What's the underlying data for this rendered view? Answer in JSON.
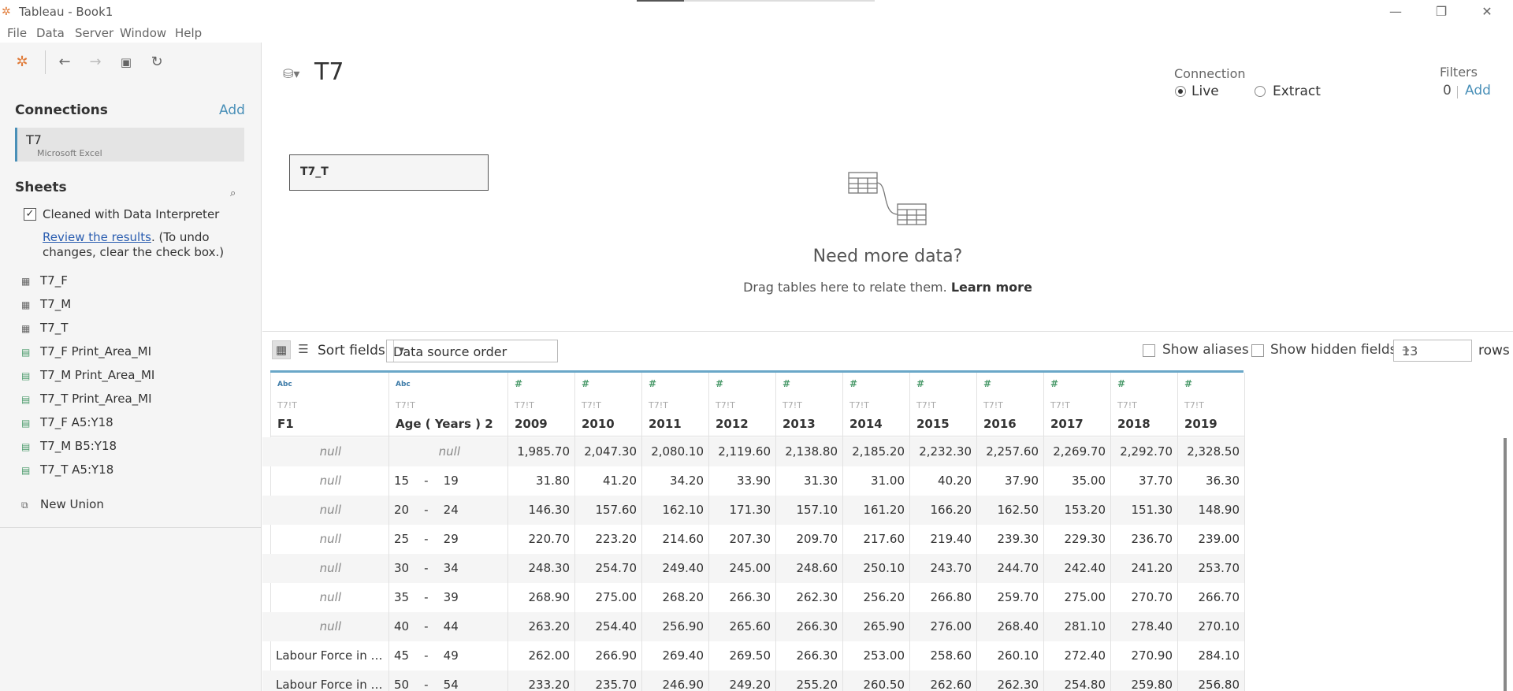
{
  "window": {
    "title": "Tableau - Book1",
    "progress_fraction": 0.2
  },
  "menu": [
    "File",
    "Data",
    "Server",
    "Window",
    "Help"
  ],
  "left": {
    "connections_title": "Connections",
    "connections_add": "Add",
    "connection": {
      "name": "T7",
      "type": "Microsoft Excel"
    },
    "sheets_title": "Sheets",
    "interpreter_label": "Cleaned with Data Interpreter",
    "interpreter_checked": true,
    "review_link": "Review the results",
    "review_rest": ". (To undo changes, clear the check box.)",
    "sheets": [
      {
        "name": "T7_F",
        "icon": "table-icon"
      },
      {
        "name": "T7_M",
        "icon": "table-icon"
      },
      {
        "name": "T7_T",
        "icon": "table-icon"
      },
      {
        "name": "T7_F Print_Area_MI",
        "icon": "named-range-icon"
      },
      {
        "name": "T7_M Print_Area_MI",
        "icon": "named-range-icon"
      },
      {
        "name": "T7_T Print_Area_MI",
        "icon": "named-range-icon"
      },
      {
        "name": "T7_F A5:Y18",
        "icon": "named-range-icon"
      },
      {
        "name": "T7_M B5:Y18",
        "icon": "named-range-icon"
      },
      {
        "name": "T7_T A5:Y18",
        "icon": "named-range-icon"
      }
    ],
    "new_union": "New Union"
  },
  "canvas": {
    "datasource_title": "T7",
    "connection_label": "Connection",
    "live_label": "Live",
    "extract_label": "Extract",
    "filters_label": "Filters",
    "filters_count": "0",
    "filters_add": "Add",
    "table_name": "T7_T",
    "need_title": "Need more data?",
    "need_sub": "Drag tables here to relate them.",
    "learn_more": "Learn more"
  },
  "gridbar": {
    "sort_label": "Sort fields",
    "sort_value": "Data source order",
    "show_aliases": "Show aliases",
    "show_hidden": "Show hidden fields",
    "rows_value": "13",
    "rows_label": "rows"
  },
  "grid": {
    "columns": [
      {
        "type": "Abc",
        "source": "T7!T",
        "name": "F1"
      },
      {
        "type": "Abc",
        "source": "T7!T",
        "name": "Age ( Years ) 2"
      },
      {
        "type": "#",
        "source": "T7!T",
        "name": "2009"
      },
      {
        "type": "#",
        "source": "T7!T",
        "name": "2010"
      },
      {
        "type": "#",
        "source": "T7!T",
        "name": "2011"
      },
      {
        "type": "#",
        "source": "T7!T",
        "name": "2012"
      },
      {
        "type": "#",
        "source": "T7!T",
        "name": "2013"
      },
      {
        "type": "#",
        "source": "T7!T",
        "name": "2014"
      },
      {
        "type": "#",
        "source": "T7!T",
        "name": "2015"
      },
      {
        "type": "#",
        "source": "T7!T",
        "name": "2016"
      },
      {
        "type": "#",
        "source": "T7!T",
        "name": "2017"
      },
      {
        "type": "#",
        "source": "T7!T",
        "name": "2018"
      },
      {
        "type": "#",
        "source": "T7!T",
        "name": "2019"
      }
    ],
    "rows": [
      [
        "null",
        "null",
        "1,985.70",
        "2,047.30",
        "2,080.10",
        "2,119.60",
        "2,138.80",
        "2,185.20",
        "2,232.30",
        "2,257.60",
        "2,269.70",
        "2,292.70",
        "2,328.50"
      ],
      [
        "null",
        "15    -    19",
        "31.80",
        "41.20",
        "34.20",
        "33.90",
        "31.30",
        "31.00",
        "40.20",
        "37.90",
        "35.00",
        "37.70",
        "36.30"
      ],
      [
        "null",
        "20    -    24",
        "146.30",
        "157.60",
        "162.10",
        "171.30",
        "157.10",
        "161.20",
        "166.20",
        "162.50",
        "153.20",
        "151.30",
        "148.90"
      ],
      [
        "null",
        "25    -    29",
        "220.70",
        "223.20",
        "214.60",
        "207.30",
        "209.70",
        "217.60",
        "219.40",
        "239.30",
        "229.30",
        "236.70",
        "239.00"
      ],
      [
        "null",
        "30    -    34",
        "248.30",
        "254.70",
        "249.40",
        "245.00",
        "248.60",
        "250.10",
        "243.70",
        "244.70",
        "242.40",
        "241.20",
        "253.70"
      ],
      [
        "null",
        "35    -    39",
        "268.90",
        "275.00",
        "268.20",
        "266.30",
        "262.30",
        "256.20",
        "266.80",
        "259.70",
        "275.00",
        "270.70",
        "266.70"
      ],
      [
        "null",
        "40    -    44",
        "263.20",
        "254.40",
        "256.90",
        "265.60",
        "266.30",
        "265.90",
        "276.00",
        "268.40",
        "281.10",
        "278.40",
        "270.10"
      ],
      [
        "Labour Force in S...",
        "45    -    49",
        "262.00",
        "266.90",
        "269.40",
        "269.50",
        "266.30",
        "253.00",
        "258.60",
        "260.10",
        "272.40",
        "270.90",
        "284.10"
      ],
      [
        "Labour Force in S...",
        "50    -    54",
        "233.20",
        "235.70",
        "246.90",
        "249.20",
        "255.20",
        "260.50",
        "262.60",
        "262.30",
        "254.80",
        "259.80",
        "256.80"
      ]
    ]
  },
  "colors": {
    "accent": "#4a90b8",
    "link": "#2a5db0",
    "number_type": "#4a9a6a"
  }
}
